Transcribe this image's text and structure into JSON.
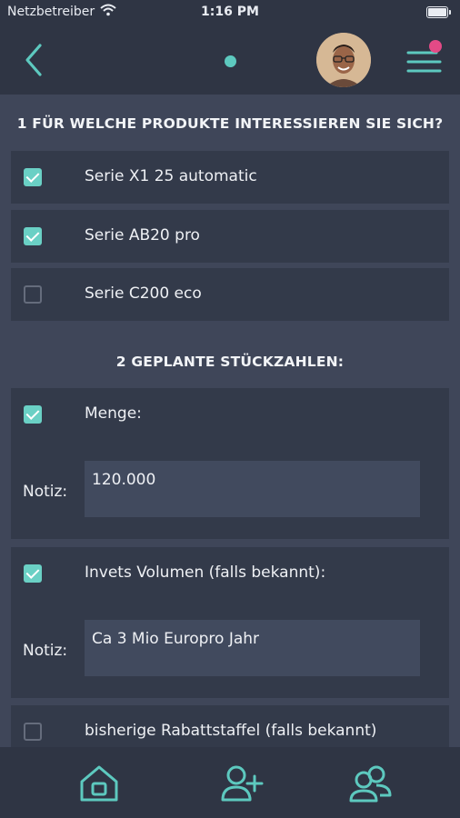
{
  "status": {
    "carrier": "Netzbetreiber",
    "time": "1:16 PM"
  },
  "colors": {
    "accent": "#5dc9bf",
    "badge": "#e34a86",
    "background": "#3f4659",
    "card": "#333a4a"
  },
  "header": {
    "back_icon": "chevron-left-icon",
    "menu_icon": "hamburger-menu-icon"
  },
  "section1": {
    "title": "1 FÜR WELCHE PRODUKTE INTERESSIEREN SIE SICH?",
    "items": [
      {
        "label": "Serie X1 25 automatic",
        "checked": true
      },
      {
        "label": "Serie AB20 pro",
        "checked": true
      },
      {
        "label": "Serie C200 eco",
        "checked": false
      }
    ]
  },
  "section2": {
    "title": "2 GEPLANTE STÜCKZAHLEN:",
    "items": [
      {
        "label": "Menge:",
        "checked": true,
        "notiz_label": "Notiz:",
        "value": "120.000"
      },
      {
        "label": "Invets Volumen (falls bekannt):",
        "checked": true,
        "notiz_label": "Notiz:",
        "value": "Ca 3 Mio Europro Jahr"
      },
      {
        "label": "bisherige Rabattstaffel (falls bekannt)",
        "checked": false
      }
    ]
  },
  "tabbar": {
    "tabs": [
      "home-icon",
      "add-user-icon",
      "users-group-icon"
    ]
  }
}
